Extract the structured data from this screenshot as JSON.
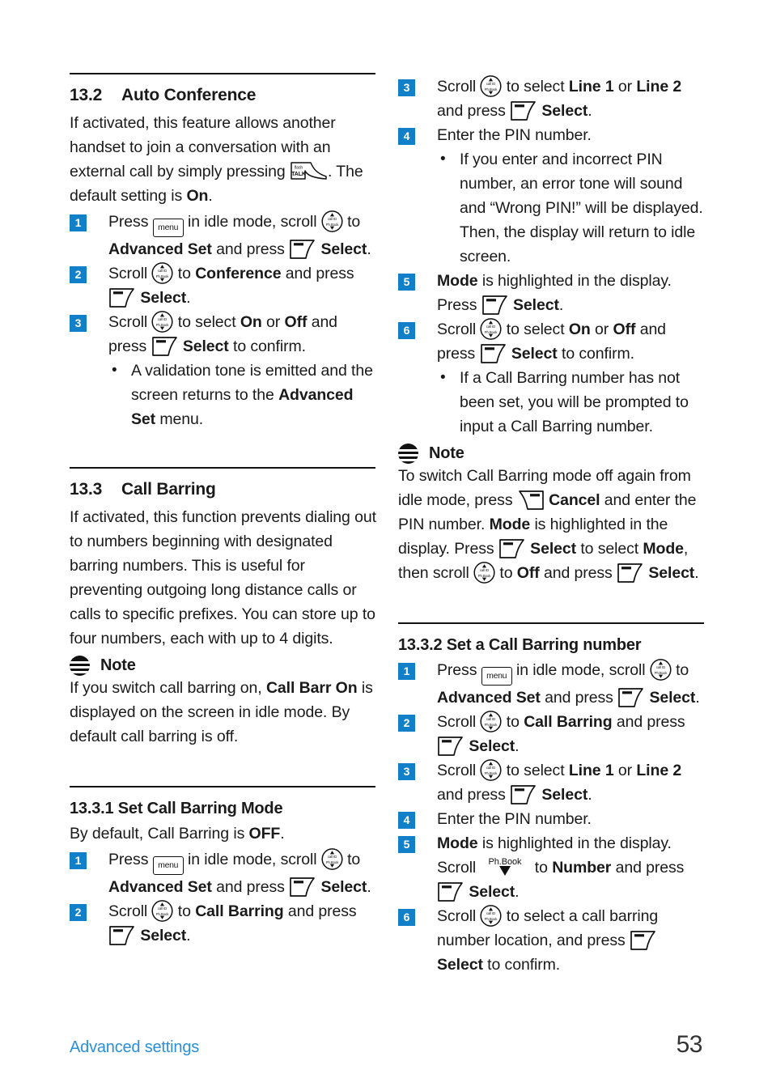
{
  "page": {
    "number": "53",
    "footer_label": "Advanced settings",
    "accent_color": "#1280c8",
    "footer_link_color": "#2a8fd6"
  },
  "icons": {
    "menu_key_label": "menu",
    "talk_key_top_label": "flash",
    "talk_key_main_label": "TALK",
    "scroll_key_top_label": "call ID",
    "scroll_key_bottom_label": "Ph.Book",
    "phbook_label": "Ph.Book"
  },
  "left_column": {
    "section_13_2": {
      "number": "13.2",
      "title": "Auto Conference",
      "intro_1": "If activated, this feature allows another handset to join a conversation with an external call by simply pressing ",
      "intro_2": ". The default setting is ",
      "intro_default": "On",
      "intro_3": ".",
      "steps": [
        {
          "badge": "1",
          "parts": [
            {
              "t": "text",
              "v": "Press "
            },
            {
              "t": "icon",
              "v": "menu-key"
            },
            {
              "t": "text",
              "v": " in idle mode, scroll "
            },
            {
              "t": "icon",
              "v": "scroll-key"
            },
            {
              "t": "text",
              "v": " to "
            },
            {
              "t": "bold",
              "v": "Advanced Set"
            },
            {
              "t": "text",
              "v": " and press "
            },
            {
              "t": "icon",
              "v": "softkey-select"
            },
            {
              "t": "bold",
              "v": " Select"
            },
            {
              "t": "text",
              "v": "."
            }
          ]
        },
        {
          "badge": "2",
          "parts": [
            {
              "t": "text",
              "v": "Scroll "
            },
            {
              "t": "icon",
              "v": "scroll-key"
            },
            {
              "t": "text",
              "v": " to "
            },
            {
              "t": "bold",
              "v": "Conference"
            },
            {
              "t": "text",
              "v": " and press "
            },
            {
              "t": "icon",
              "v": "softkey-select"
            },
            {
              "t": "bold",
              "v": " Select"
            },
            {
              "t": "text",
              "v": "."
            }
          ]
        },
        {
          "badge": "3",
          "parts": [
            {
              "t": "text",
              "v": "Scroll "
            },
            {
              "t": "icon",
              "v": "scroll-key"
            },
            {
              "t": "text",
              "v": " to select "
            },
            {
              "t": "bold",
              "v": "On"
            },
            {
              "t": "text",
              "v": " or "
            },
            {
              "t": "bold",
              "v": "Off"
            },
            {
              "t": "text",
              "v": " and press "
            },
            {
              "t": "icon",
              "v": "softkey-select"
            },
            {
              "t": "bold",
              "v": " Select"
            },
            {
              "t": "text",
              "v": " to confirm."
            }
          ],
          "bullets": [
            [
              {
                "t": "text",
                "v": "A validation tone is emitted and the screen returns to the "
              },
              {
                "t": "bold",
                "v": "Advanced Set"
              },
              {
                "t": "text",
                "v": " menu."
              }
            ]
          ]
        }
      ]
    },
    "section_13_3": {
      "number": "13.3",
      "title": "Call Barring",
      "intro": "If activated, this function prevents dialing out to numbers beginning with designated barring numbers. This is useful for preventing outgoing long distance calls or calls to specific prefixes. You can store up to four numbers, each with up to 4 digits.",
      "note": {
        "title": "Note",
        "parts": [
          {
            "t": "text",
            "v": "If you switch call barring on, "
          },
          {
            "t": "bold",
            "v": "Call Barr On"
          },
          {
            "t": "text",
            "v": " is displayed on the screen in idle mode. By default call barring is off."
          }
        ]
      }
    },
    "section_13_3_1": {
      "title": "13.3.1 Set Call Barring Mode",
      "intro_parts": [
        {
          "t": "text",
          "v": "By default, Call Barring is "
        },
        {
          "t": "bold",
          "v": "OFF"
        },
        {
          "t": "text",
          "v": "."
        }
      ],
      "steps": [
        {
          "badge": "1",
          "parts": [
            {
              "t": "text",
              "v": "Press "
            },
            {
              "t": "icon",
              "v": "menu-key"
            },
            {
              "t": "text",
              "v": " in idle mode, scroll "
            },
            {
              "t": "icon",
              "v": "scroll-key"
            },
            {
              "t": "text",
              "v": " to "
            },
            {
              "t": "bold",
              "v": "Advanced Set"
            },
            {
              "t": "text",
              "v": " and press "
            },
            {
              "t": "icon",
              "v": "softkey-select"
            },
            {
              "t": "bold",
              "v": " Select"
            },
            {
              "t": "text",
              "v": "."
            }
          ]
        },
        {
          "badge": "2",
          "parts": [
            {
              "t": "text",
              "v": "Scroll "
            },
            {
              "t": "icon",
              "v": "scroll-key"
            },
            {
              "t": "text",
              "v": " to "
            },
            {
              "t": "bold",
              "v": "Call Barring"
            },
            {
              "t": "text",
              "v": " and press "
            },
            {
              "t": "icon",
              "v": "softkey-select"
            },
            {
              "t": "bold",
              "v": " Select"
            },
            {
              "t": "text",
              "v": "."
            }
          ]
        }
      ]
    }
  },
  "right_column": {
    "section_13_3_1_cont": {
      "steps": [
        {
          "badge": "3",
          "parts": [
            {
              "t": "text",
              "v": "Scroll "
            },
            {
              "t": "icon",
              "v": "scroll-key"
            },
            {
              "t": "text",
              "v": " to select "
            },
            {
              "t": "bold",
              "v": "Line 1"
            },
            {
              "t": "text",
              "v": " or "
            },
            {
              "t": "bold",
              "v": "Line 2"
            },
            {
              "t": "text",
              "v": " and press "
            },
            {
              "t": "icon",
              "v": "softkey-select"
            },
            {
              "t": "bold",
              "v": " Select"
            },
            {
              "t": "text",
              "v": "."
            }
          ]
        },
        {
          "badge": "4",
          "parts": [
            {
              "t": "text",
              "v": "Enter the PIN number."
            }
          ],
          "bullets": [
            [
              {
                "t": "text",
                "v": "If you enter and incorrect PIN number, an error tone will sound and “Wrong PIN!” will be displayed. Then, the display will return to idle screen."
              }
            ]
          ]
        },
        {
          "badge": "5",
          "parts": [
            {
              "t": "bold",
              "v": "Mode"
            },
            {
              "t": "text",
              "v": " is highlighted in the display. Press "
            },
            {
              "t": "icon",
              "v": "softkey-select"
            },
            {
              "t": "bold",
              "v": " Select"
            },
            {
              "t": "text",
              "v": "."
            }
          ]
        },
        {
          "badge": "6",
          "parts": [
            {
              "t": "text",
              "v": "Scroll "
            },
            {
              "t": "icon",
              "v": "scroll-key"
            },
            {
              "t": "text",
              "v": " to select "
            },
            {
              "t": "bold",
              "v": "On"
            },
            {
              "t": "text",
              "v": " or "
            },
            {
              "t": "bold",
              "v": "Off"
            },
            {
              "t": "text",
              "v": " and press "
            },
            {
              "t": "icon",
              "v": "softkey-select"
            },
            {
              "t": "bold",
              "v": " Select"
            },
            {
              "t": "text",
              "v": " to confirm."
            }
          ],
          "bullets": [
            [
              {
                "t": "text",
                "v": "If a Call Barring number has not been set, you will be prompted to input a Call Barring number."
              }
            ]
          ]
        }
      ],
      "note": {
        "title": "Note",
        "parts": [
          {
            "t": "text",
            "v": "To switch Call Barring mode off again from idle mode, press "
          },
          {
            "t": "icon",
            "v": "softkey-cancel"
          },
          {
            "t": "bold",
            "v": " Cancel"
          },
          {
            "t": "text",
            "v": " and enter the PIN number. "
          },
          {
            "t": "bold",
            "v": "Mode"
          },
          {
            "t": "text",
            "v": " is highlighted in the display. Press "
          },
          {
            "t": "icon",
            "v": "softkey-select"
          },
          {
            "t": "bold",
            "v": " Select"
          },
          {
            "t": "text",
            "v": " to select "
          },
          {
            "t": "bold",
            "v": "Mode"
          },
          {
            "t": "text",
            "v": ", then scroll "
          },
          {
            "t": "icon",
            "v": "scroll-key"
          },
          {
            "t": "text",
            "v": " to "
          },
          {
            "t": "bold",
            "v": "Off"
          },
          {
            "t": "text",
            "v": " and press "
          },
          {
            "t": "icon",
            "v": "softkey-select"
          },
          {
            "t": "bold",
            "v": " Select"
          },
          {
            "t": "text",
            "v": "."
          }
        ]
      }
    },
    "section_13_3_2": {
      "title": "13.3.2 Set a Call Barring number",
      "steps": [
        {
          "badge": "1",
          "parts": [
            {
              "t": "text",
              "v": "Press "
            },
            {
              "t": "icon",
              "v": "menu-key"
            },
            {
              "t": "text",
              "v": " in idle mode, scroll "
            },
            {
              "t": "icon",
              "v": "scroll-key"
            },
            {
              "t": "text",
              "v": " to "
            },
            {
              "t": "bold",
              "v": "Advanced Set"
            },
            {
              "t": "text",
              "v": " and press "
            },
            {
              "t": "icon",
              "v": "softkey-select"
            },
            {
              "t": "bold",
              "v": " Select"
            },
            {
              "t": "text",
              "v": "."
            }
          ]
        },
        {
          "badge": "2",
          "parts": [
            {
              "t": "text",
              "v": "Scroll "
            },
            {
              "t": "icon",
              "v": "scroll-key"
            },
            {
              "t": "text",
              "v": " to "
            },
            {
              "t": "bold",
              "v": "Call Barring"
            },
            {
              "t": "text",
              "v": " and press "
            },
            {
              "t": "icon",
              "v": "softkey-select"
            },
            {
              "t": "bold",
              "v": " Select"
            },
            {
              "t": "text",
              "v": "."
            }
          ]
        },
        {
          "badge": "3",
          "parts": [
            {
              "t": "text",
              "v": "Scroll "
            },
            {
              "t": "icon",
              "v": "scroll-key"
            },
            {
              "t": "text",
              "v": " to select "
            },
            {
              "t": "bold",
              "v": "Line 1"
            },
            {
              "t": "text",
              "v": " or "
            },
            {
              "t": "bold",
              "v": "Line 2"
            },
            {
              "t": "text",
              "v": " and press "
            },
            {
              "t": "icon",
              "v": "softkey-select"
            },
            {
              "t": "bold",
              "v": " Select"
            },
            {
              "t": "text",
              "v": "."
            }
          ]
        },
        {
          "badge": "4",
          "parts": [
            {
              "t": "text",
              "v": "Enter the PIN number."
            }
          ]
        },
        {
          "badge": "5",
          "parts": [
            {
              "t": "bold",
              "v": "Mode"
            },
            {
              "t": "text",
              "v": " is highlighted in the display. Scroll "
            },
            {
              "t": "icon",
              "v": "phbook-down-key"
            },
            {
              "t": "text",
              "v": " to "
            },
            {
              "t": "bold",
              "v": "Number"
            },
            {
              "t": "text",
              "v": " and press "
            },
            {
              "t": "icon",
              "v": "softkey-select"
            },
            {
              "t": "bold",
              "v": " Select"
            },
            {
              "t": "text",
              "v": "."
            }
          ]
        },
        {
          "badge": "6",
          "parts": [
            {
              "t": "text",
              "v": "Scroll "
            },
            {
              "t": "icon",
              "v": "scroll-key"
            },
            {
              "t": "text",
              "v": " to select a call barring number location, and press "
            },
            {
              "t": "icon",
              "v": "softkey-select"
            },
            {
              "t": "bold",
              "v": " Select"
            },
            {
              "t": "text",
              "v": " to confirm."
            }
          ]
        }
      ]
    }
  }
}
